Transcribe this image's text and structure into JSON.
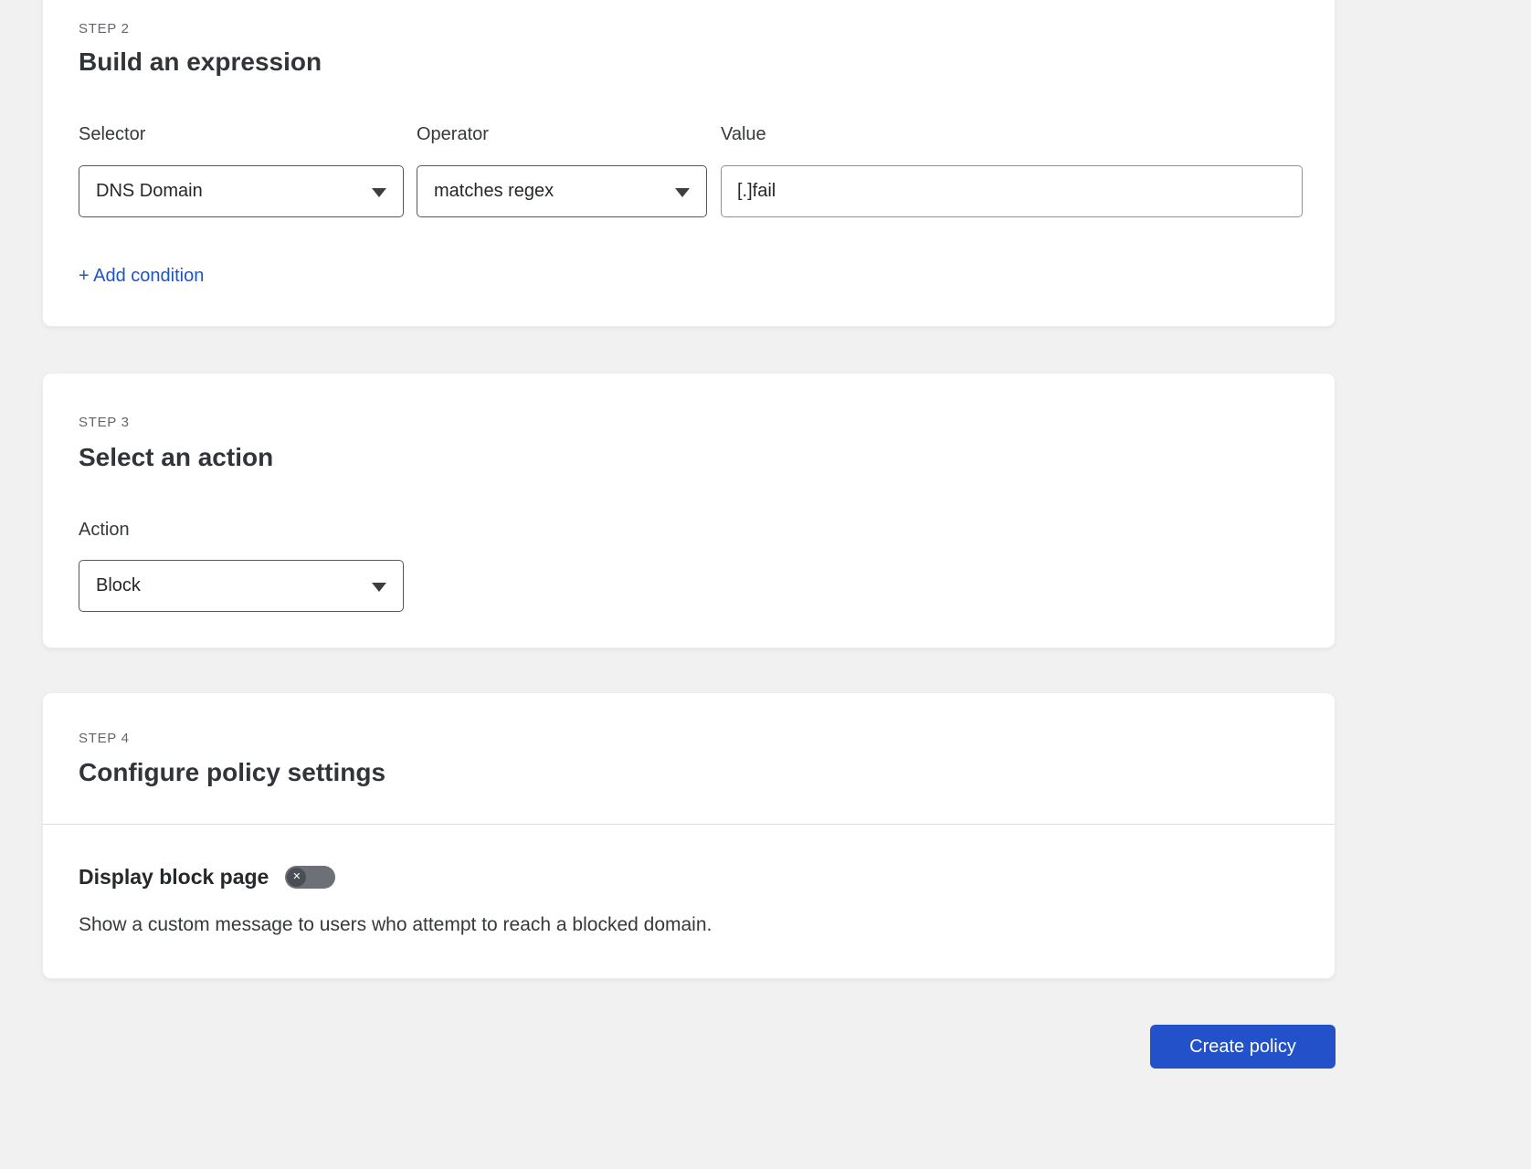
{
  "step2": {
    "step_label": "STEP 2",
    "title": "Build an expression",
    "selector": {
      "label": "Selector",
      "value": "DNS Domain"
    },
    "operator": {
      "label": "Operator",
      "value": "matches regex"
    },
    "value_field": {
      "label": "Value",
      "value": "[.]fail"
    },
    "add_condition_label": "+ Add condition"
  },
  "step3": {
    "step_label": "STEP 3",
    "title": "Select an action",
    "action": {
      "label": "Action",
      "value": "Block"
    }
  },
  "step4": {
    "step_label": "STEP 4",
    "title": "Configure policy settings",
    "display_block_page": {
      "label": "Display block page",
      "state": "off",
      "description": "Show a custom message to users who attempt to reach a blocked domain."
    }
  },
  "footer": {
    "create_policy_label": "Create policy"
  },
  "colors": {
    "page_bg": "#f1f1f1",
    "card_bg": "#ffffff",
    "link_blue": "#1a56c9",
    "button_blue": "#2251c9",
    "toggle_off_gray": "#6d7077"
  }
}
